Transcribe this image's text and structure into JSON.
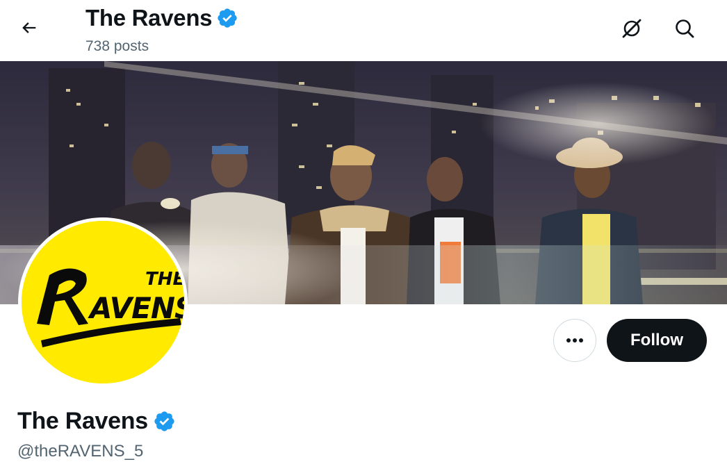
{
  "header": {
    "title": "The Ravens",
    "posts_count": "738 posts"
  },
  "profile": {
    "display_name": "The Ravens",
    "handle": "@theRAVENS_5",
    "verified": true,
    "avatar_logo": {
      "line1": "THE",
      "line2": "RAVENS"
    }
  },
  "actions": {
    "follow_label": "Follow",
    "more_label": "More"
  },
  "icons": {
    "back": "arrow-left-icon",
    "grok": "grok-icon",
    "search": "search-icon",
    "verified": "verified-badge-icon",
    "more": "more-dots-icon"
  },
  "colors": {
    "verified": "#1d9bf0",
    "follow_bg": "#0f1419",
    "avatar_bg": "#ffea00",
    "secondary_text": "#536471"
  }
}
